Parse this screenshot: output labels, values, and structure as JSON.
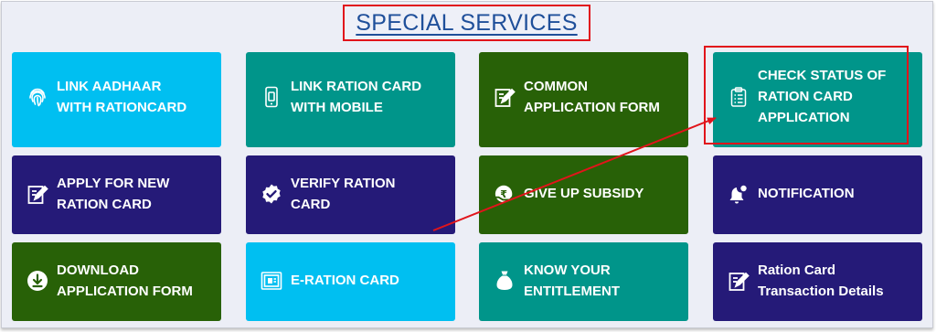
{
  "section": {
    "title": "SPECIAL SERVICES"
  },
  "colors": {
    "sky": "#00bff1",
    "teal": "#00958a",
    "green": "#286107",
    "navy": "#251a78",
    "annotation_red": "#e1141b",
    "title_blue": "#1f4f9a"
  },
  "cards": [
    {
      "label": "LINK AADHAAR\nWITH RATIONCARD",
      "icon": "fingerprint-icon",
      "color": "sky"
    },
    {
      "label": "LINK RATION CARD\nWITH MOBILE",
      "icon": "mobile-icon",
      "color": "teal"
    },
    {
      "label": "COMMON\nAPPLICATION FORM",
      "icon": "edit-form-icon",
      "color": "green"
    },
    {
      "label": "CHECK STATUS OF\nRATION CARD\nAPPLICATION",
      "icon": "clipboard-icon",
      "color": "teal"
    },
    {
      "label": "APPLY FOR NEW\nRATION CARD",
      "icon": "edit-form-icon",
      "color": "navy"
    },
    {
      "label": "VERIFY RATION\nCARD",
      "icon": "verified-badge-icon",
      "color": "navy"
    },
    {
      "label": "GIVE UP SUBSIDY",
      "icon": "hand-rupee-icon",
      "color": "green"
    },
    {
      "label": "NOTIFICATION",
      "icon": "bell-icon",
      "color": "navy"
    },
    {
      "label": "DOWNLOAD\nAPPLICATION FORM",
      "icon": "download-icon",
      "color": "green"
    },
    {
      "label": "E-RATION CARD",
      "icon": "id-card-icon",
      "color": "sky"
    },
    {
      "label": "KNOW YOUR\nENTITLEMENT",
      "icon": "grain-bag-icon",
      "color": "teal"
    },
    {
      "label": "Ration Card\nTransaction Details",
      "icon": "edit-form-icon",
      "color": "navy"
    }
  ]
}
